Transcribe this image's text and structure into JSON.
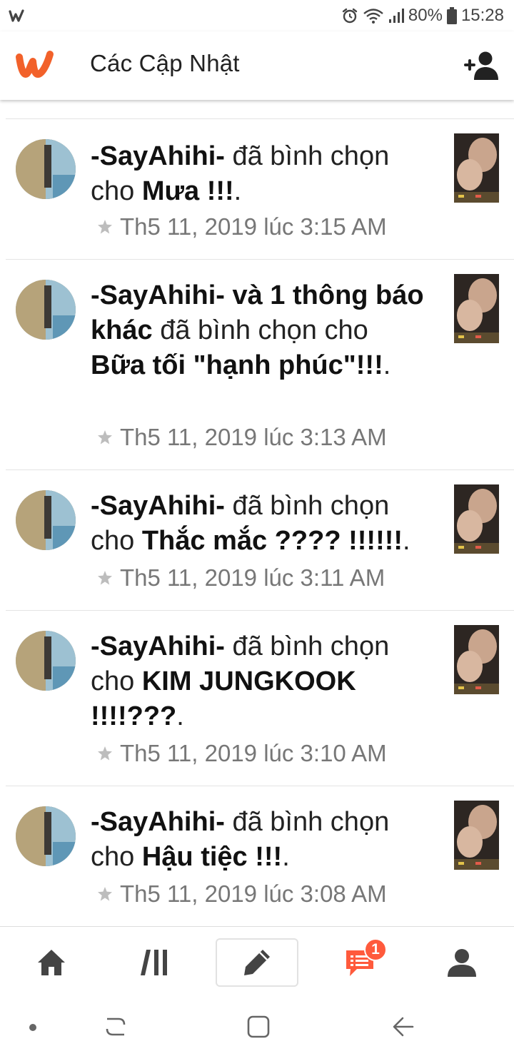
{
  "status_bar": {
    "app_icon": "wattpad-w-icon",
    "icons": [
      "alarm-icon",
      "wifi-icon",
      "signal-icon"
    ],
    "battery": "80%",
    "battery_icon": "battery-icon",
    "time": "15:28"
  },
  "header": {
    "logo_icon": "wattpad-logo-icon",
    "title": "Các Cập Nhật",
    "action_icon": "add-friend-icon"
  },
  "notifications": [
    {
      "user": "-SayAhihi-",
      "others": "",
      "action": "đã bình chọn cho",
      "story": "Mưa !!!",
      "time": "Th5 11, 2019 lúc 3:15 AM"
    },
    {
      "user": "-SayAhihi-",
      "others": "và 1 thông báo khác",
      "action": "đã bình chọn cho",
      "story": "Bữa tối \"hạnh phúc\"!!!",
      "time": "Th5 11, 2019 lúc 3:13 AM"
    },
    {
      "user": "-SayAhihi-",
      "others": "",
      "action": "đã bình chọn cho",
      "story": "Thắc mắc ???? !!!!!!",
      "time": "Th5 11, 2019 lúc 3:11 AM"
    },
    {
      "user": "-SayAhihi-",
      "others": "",
      "action": "đã bình chọn cho",
      "story": "KIM JUNGKOOK !!!!???",
      "time": "Th5 11, 2019 lúc 3:10 AM"
    },
    {
      "user": "-SayAhihi-",
      "others": "",
      "action": "đã bình chọn cho",
      "story": "Hậu tiệc !!!",
      "time": "Th5 11, 2019 lúc 3:08 AM"
    }
  ],
  "bottom_nav": {
    "items": [
      "home-icon",
      "library-icon",
      "write-icon",
      "notifications-icon",
      "profile-icon"
    ],
    "badge": "1",
    "accent": "#ff5a3c"
  },
  "system_nav": {
    "items": [
      "dot-icon",
      "recents-icon",
      "home-square-icon",
      "back-arrow-icon"
    ]
  }
}
